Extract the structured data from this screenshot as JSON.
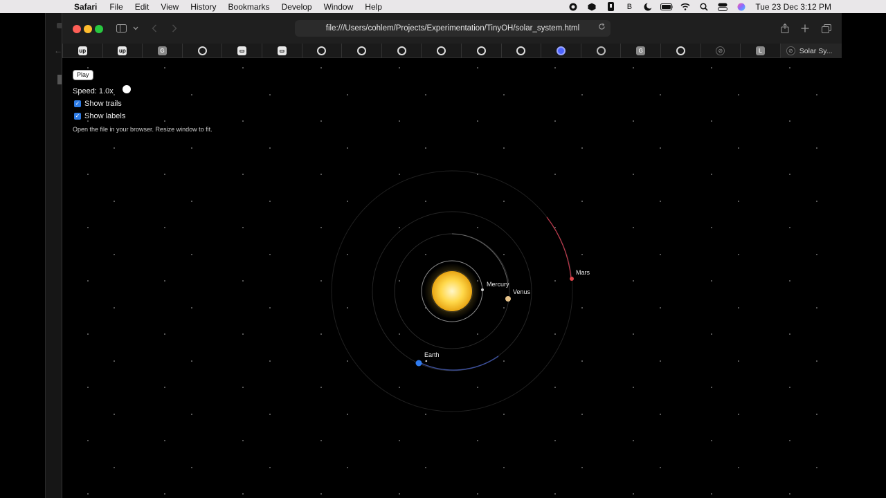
{
  "menubar": {
    "app": "Safari",
    "items": [
      "File",
      "Edit",
      "View",
      "History",
      "Bookmarks",
      "Develop",
      "Window",
      "Help"
    ],
    "status_letter": "B",
    "clock": "Tue 23 Dec  3:12 PM"
  },
  "browser": {
    "url": "file:///Users/cohlem/Projects/Experimentation/TinyOH/solar_system.html",
    "tabs": [
      {
        "icon": "up-icon",
        "glyph": "up"
      },
      {
        "icon": "up-icon",
        "glyph": "up"
      },
      {
        "icon": "g-icon",
        "glyph": "G"
      },
      {
        "icon": "github-icon",
        "glyph": ""
      },
      {
        "icon": "app-icon",
        "glyph": "▭"
      },
      {
        "icon": "app-icon",
        "glyph": "▭"
      },
      {
        "icon": "github-icon",
        "glyph": ""
      },
      {
        "icon": "github-icon",
        "glyph": ""
      },
      {
        "icon": "github-icon",
        "glyph": ""
      },
      {
        "icon": "github-icon",
        "glyph": ""
      },
      {
        "icon": "github-icon",
        "glyph": ""
      },
      {
        "icon": "github-icon",
        "glyph": ""
      },
      {
        "icon": "blue-circle-icon",
        "glyph": ""
      },
      {
        "icon": "openai-icon",
        "glyph": ""
      },
      {
        "icon": "g-icon",
        "glyph": "G"
      },
      {
        "icon": "github-icon",
        "glyph": ""
      },
      {
        "icon": "compass-icon",
        "glyph": "⊘"
      },
      {
        "icon": "l-icon",
        "glyph": "L"
      }
    ],
    "active_tab_title": "Solar Sy..."
  },
  "controls": {
    "play_label": "Play",
    "speed_label": "Speed: 1.0x",
    "speed_value": 1.0,
    "show_trails_label": "Show trails",
    "show_trails": true,
    "show_labels_label": "Show labels",
    "show_labels": true,
    "hint": "Open the file in your browser. Resize window to fit."
  },
  "planets": [
    {
      "name": "Mercury",
      "color": "#c9c9c9"
    },
    {
      "name": "Venus",
      "color": "#e8c48a"
    },
    {
      "name": "Earth",
      "color": "#2f7bf0"
    },
    {
      "name": "Mars",
      "color": "#e0454a"
    }
  ],
  "colors": {
    "sun_core": "#fff3b0",
    "sun_edge": "#e8a514",
    "mars_trail": "#c0394c",
    "earth_trail": "#3c4f9a",
    "orbit": "#2b2b2b"
  }
}
